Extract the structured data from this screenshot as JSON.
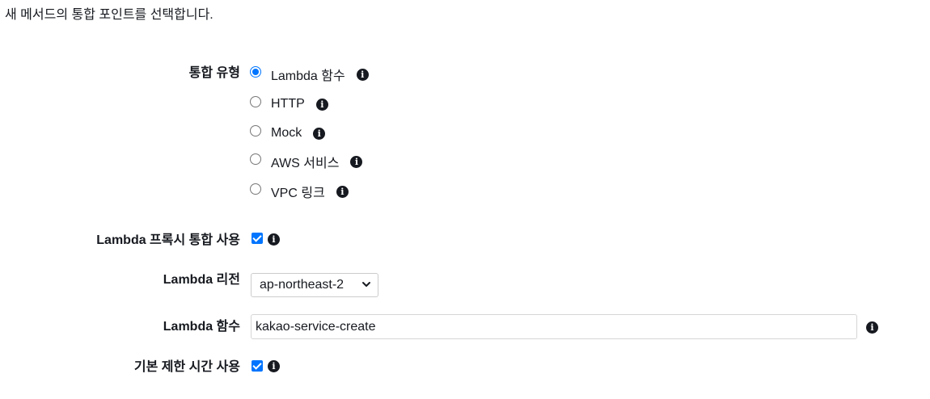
{
  "intro_text": "새 메서드의 통합 포인트를 선택합니다.",
  "integration_type": {
    "label": "통합 유형",
    "options": [
      {
        "label": "Lambda 함수",
        "checked": true
      },
      {
        "label": "HTTP",
        "checked": false
      },
      {
        "label": "Mock",
        "checked": false
      },
      {
        "label": "AWS 서비스",
        "checked": false
      },
      {
        "label": "VPC 링크",
        "checked": false
      }
    ]
  },
  "proxy_integration": {
    "label": "Lambda 프록시 통합 사용",
    "checked": true
  },
  "region": {
    "label": "Lambda 리전",
    "value": "ap-northeast-2"
  },
  "function": {
    "label": "Lambda 함수",
    "value": "kakao-service-create"
  },
  "default_timeout": {
    "label": "기본 제한 시간 사용",
    "checked": true
  },
  "icons": {
    "info": "info-icon",
    "chevron": "chevron-down-icon"
  },
  "colors": {
    "accent": "#0075ff",
    "text": "#16191f",
    "border": "#cccccc"
  }
}
